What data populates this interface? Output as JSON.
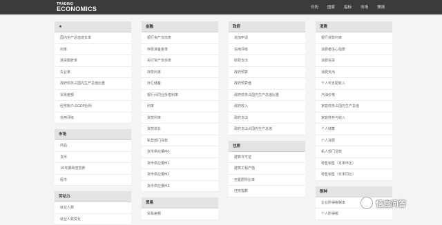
{
  "header": {
    "logo_line1": "TRADING",
    "logo_line2": "ECONOMICS",
    "nav": [
      "日历",
      "国家",
      "指标",
      "市场",
      "预测"
    ]
  },
  "columns": [
    {
      "sections": [
        {
          "title": "★",
          "items": [
            "国内生产总值增长率",
            "利率",
            "通货膨胀率",
            "失业率",
            "政府债务占国内生产总值比重",
            "贸易差额",
            "经常账户占GDP比例",
            "信用评级"
          ]
        },
        {
          "title": "市场",
          "items": [
            "商品",
            "货币",
            "10年期政府债券",
            "股市"
          ]
        },
        {
          "title": "劳动力",
          "items": [
            "就业人数",
            "就业人数变化"
          ]
        }
      ]
    },
    {
      "sections": [
        {
          "title": "金融",
          "items": [
            "银行资产负债表",
            "存款准备金率",
            "央行资产负债表",
            "存款利率",
            "外汇储备",
            "银行间同业拆借利率",
            "利率",
            "贷款利率",
            "贷款增长",
            "私营部门贷款",
            "货币供应量M0",
            "货币供应量M1",
            "货币供应量M2",
            "货币供应量M3"
          ]
        },
        {
          "title": "贸易",
          "items": [
            "贸易差额"
          ]
        }
      ]
    },
    {
      "sections": [
        {
          "title": "政府",
          "items": [
            "追加申请",
            "信用评级",
            "财政支出",
            "政府预算",
            "政府预算值",
            "政府债务占国内生产总值比重",
            "政府收入",
            "政府支出",
            "政府支出占国内生产总值"
          ]
        },
        {
          "title": "住房",
          "items": [
            "建筑许可证",
            "建筑工程产值",
            "自置居所比率",
            "住房指数"
          ]
        }
      ]
    },
    {
      "sections": [
        {
          "title": "消费",
          "items": [
            "银行贷款利率",
            "消费者信心指数",
            "消费信贷",
            "消费支出",
            "个人可支配收入",
            "汽油价格",
            "家庭债务占国内生产总值",
            "家庭债务与收入",
            "个人储蓄",
            "个人消费",
            "私人部门贷款",
            "零售销售（月率环比）",
            "零售销售（年率同比）"
          ]
        },
        {
          "title": "税种",
          "items": [
            "企业所得税税率",
            "个人所得税"
          ]
        }
      ]
    }
  ],
  "watermark": {
    "text": "悟空问答"
  }
}
